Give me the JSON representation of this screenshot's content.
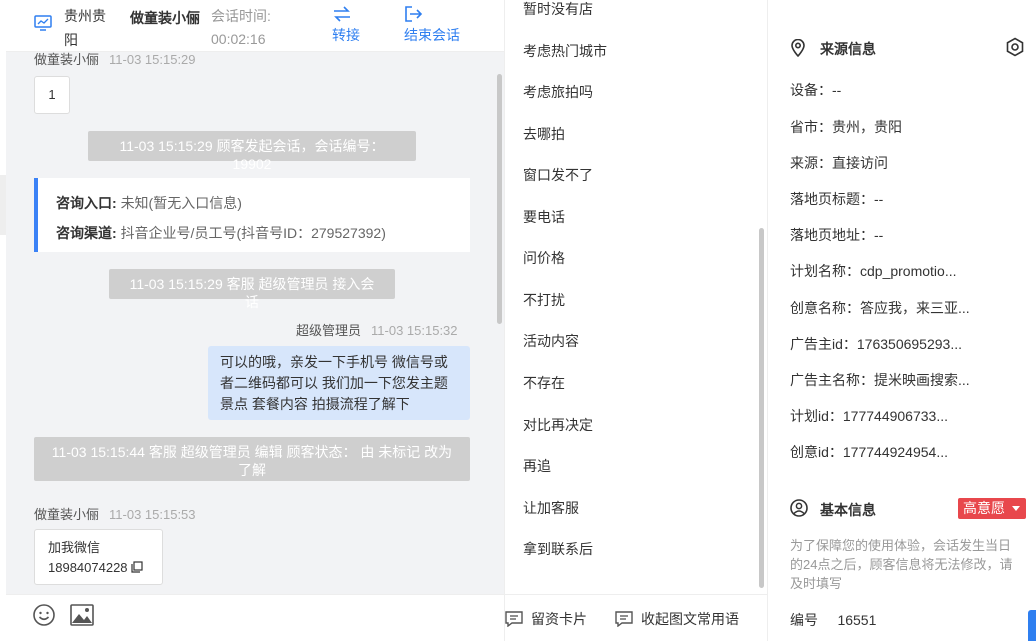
{
  "header": {
    "location": "贵州贵阳",
    "customer_name": "做童装小俪",
    "session_time_label": "会话时间:",
    "session_time": "00:02:16",
    "transfer_label": "转接",
    "end_label": "结束会话"
  },
  "chat": {
    "top_meta_name": "做童装小俪",
    "top_meta_time": "11-03 15:15:29",
    "top_bubble": "1",
    "sys_start": "11-03 15:15:29 顾客发起会话，会话编号：19902",
    "entry_label": "咨询入口:",
    "entry_value": "未知(暂无入口信息)",
    "channel_label": "咨询渠道:",
    "channel_value": "抖音企业号/员工号(抖音号ID：279527392)",
    "sys_join": "11-03 15:15:29 客服 超级管理员 接入会话",
    "agent_name": "超级管理员",
    "agent_time": "11-03 15:15:32",
    "agent_message": "可以的哦，亲发一下手机号 微信号或者二维码都可以 我们加一下您发主题景点 套餐内容 拍摄流程了解下",
    "sys_edit": "11-03 15:15:44 客服 超级管理员 编辑 顾客状态： 由 未标记 改为 了解",
    "customer_name": "做童装小俪",
    "customer_time": "11-03 15:15:53",
    "wechat_label": "加我微信",
    "wechat_number": "18984074228"
  },
  "toolbar": {
    "emoji_icon": "emoji-icon",
    "image_icon": "image-icon"
  },
  "quick_replies": [
    "暂时没有店",
    "考虑热门城市",
    "考虑旅拍吗",
    "去哪拍",
    "窗口发不了",
    "要电话",
    "问价格",
    "不打扰",
    "活动内容",
    "不存在",
    "对比再决定",
    "再追",
    "让加客服",
    "拿到联系后"
  ],
  "replies_footer": {
    "card_label": "留资卡片",
    "collect_label": "收起图文常用语"
  },
  "source_info": {
    "title": "来源信息",
    "fields": [
      "设备：--",
      "省市：贵州，贵阳",
      "来源：直接访问",
      "落地页标题：--",
      "落地页地址：--",
      "计划名称：cdp_promotio...",
      "创意名称：答应我，来三亚...",
      "广告主id：176350695293...",
      "广告主名称：提米映画搜索...",
      "计划id：177744906733...",
      "创意id：177744924954..."
    ]
  },
  "basic_info": {
    "title": "基本信息",
    "intent_badge": "高意愿",
    "note": "为了保障您的使用体验，会话发生当日的24点之后，顾客信息将无法修改，请及时填写",
    "id_label": "编号",
    "id_value": "16551"
  },
  "colors": {
    "accent": "#2f7ff0",
    "badge": "#e8474c",
    "agent_bubble": "#d7e6fb",
    "system_msg": "#cfcfcf"
  }
}
